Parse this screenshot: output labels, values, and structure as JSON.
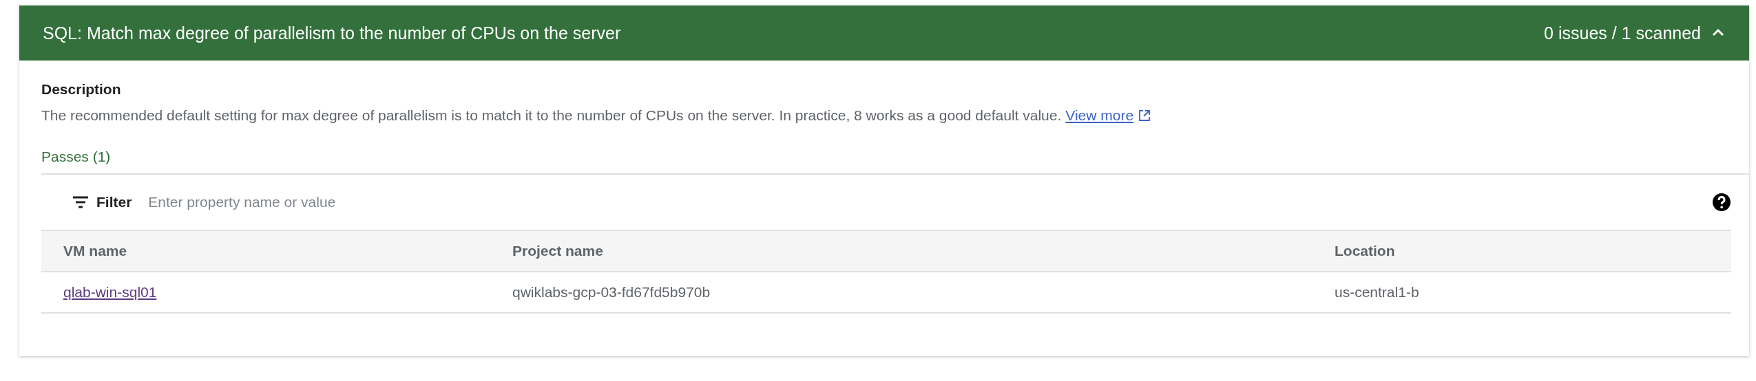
{
  "header": {
    "title": "SQL: Match max degree of parallelism to the number of CPUs on the server",
    "summary": "0 issues / 1 scanned",
    "expanded": true
  },
  "description": {
    "label": "Description",
    "text": "The recommended default setting for max degree of parallelism is to match it to the number of CPUs on the server. In practice, 8 works as a good default value.",
    "link": "View more"
  },
  "passes": {
    "label": "Passes (1)"
  },
  "filter": {
    "label": "Filter",
    "placeholder": "Enter property name or value"
  },
  "table": {
    "columns": [
      "VM name",
      "Project name",
      "Location"
    ],
    "rows": [
      {
        "cells": [
          "qlab-win-sql01",
          "qwiklabs-gcp-03-fd67fd5b970b",
          "us-central1-b"
        ]
      }
    ]
  }
}
